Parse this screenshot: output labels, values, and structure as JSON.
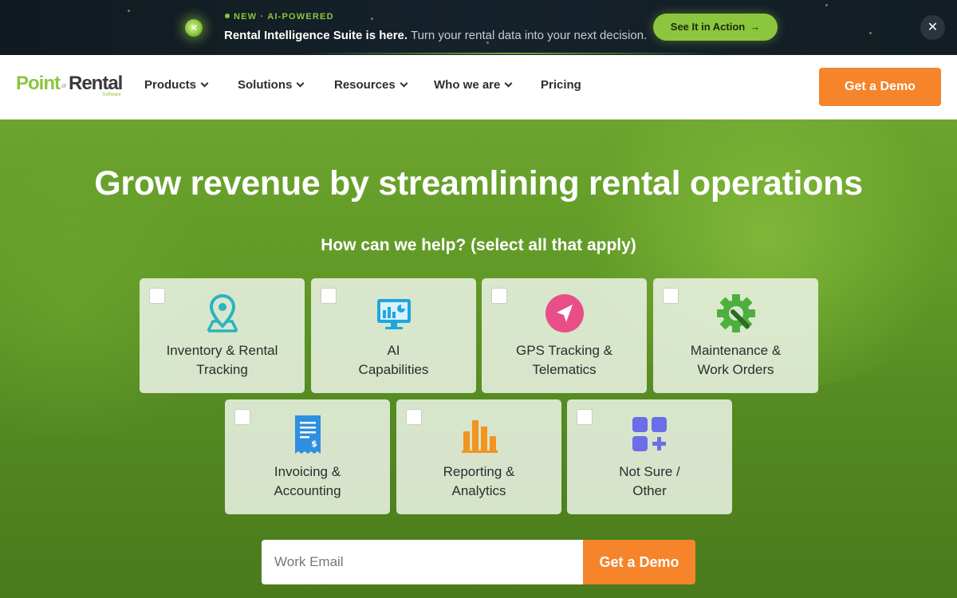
{
  "announcement": {
    "tag": "NEW · AI-POWERED",
    "headline": "Rental Intelligence Suite is here.",
    "message": " Turn your rental data into your next decision.",
    "cta_label": "See It in Action",
    "cta_arrow": "→",
    "close_glyph": "✕",
    "orb_glyph": "✕"
  },
  "brand": {
    "logo_part1": "Point",
    "logo_by": "of",
    "logo_part2": "Rental",
    "logo_sub": "Software",
    "accent": "#8cc63f",
    "cta_color": "#f5842a"
  },
  "nav": {
    "items": [
      {
        "label": "Products"
      },
      {
        "label": "Solutions"
      },
      {
        "label": "Resources"
      },
      {
        "label": "Who we are"
      },
      {
        "label": "Pricing"
      }
    ],
    "cta_label": "Get a Demo"
  },
  "hero": {
    "title": "Grow revenue by streamlining rental operations",
    "subtitle": "How can we help? (select all that apply)"
  },
  "options": [
    {
      "label": "Inventory & Rental\nTracking",
      "icon": "map-pin-icon",
      "checked": false
    },
    {
      "label": "AI\nCapabilities",
      "icon": "analytics-monitor-icon",
      "checked": false
    },
    {
      "label": "GPS Tracking &\nTelematics",
      "icon": "navigation-arrow-icon",
      "checked": false
    },
    {
      "label": "Maintenance &\nWork Orders",
      "icon": "gear-wrench-icon",
      "checked": false
    },
    {
      "label": "Invoicing &\nAccounting",
      "icon": "invoice-icon",
      "checked": false
    },
    {
      "label": "Reporting &\nAnalytics",
      "icon": "bar-chart-icon",
      "checked": false
    },
    {
      "label": "Not Sure /\nOther",
      "icon": "grid-plus-icon",
      "checked": false
    }
  ],
  "form": {
    "email_placeholder": "Work Email",
    "email_value": "",
    "submit_label": "Get a Demo"
  }
}
